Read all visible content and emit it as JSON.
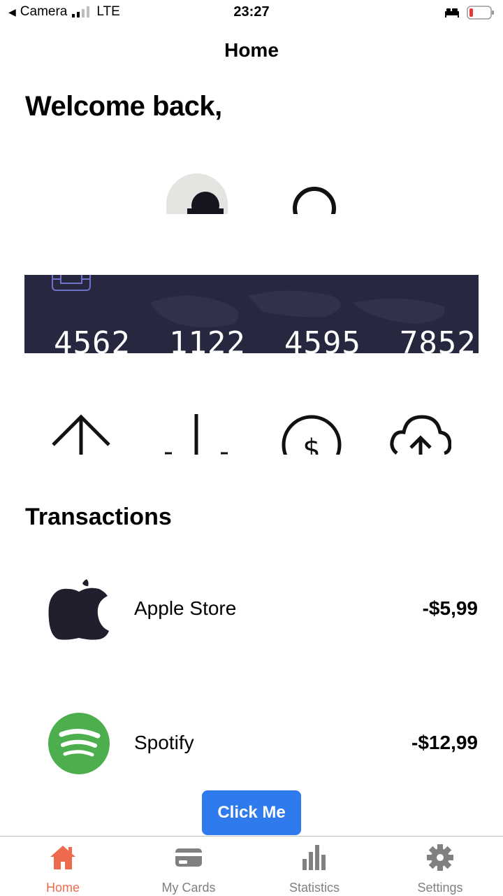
{
  "status_bar": {
    "back_app": "Camera",
    "network": "LTE",
    "time": "23:27"
  },
  "header": {
    "title": "Home"
  },
  "welcome_text": "Welcome back,",
  "card": {
    "number": "4562  1122  4595  7852",
    "color": "#27273f"
  },
  "actions": [
    {
      "icon": "arrow-up-icon"
    },
    {
      "icon": "arrow-down-icon"
    },
    {
      "icon": "dollar-circle-icon"
    },
    {
      "icon": "cloud-upload-icon"
    }
  ],
  "transactions": {
    "title": "Transactions",
    "items": [
      {
        "name": "Apple Store",
        "amount": "-$5,99",
        "icon": "apple-icon"
      },
      {
        "name": "Spotify",
        "amount": "-$12,99",
        "icon": "spotify-icon"
      }
    ]
  },
  "click_button": {
    "label": "Click Me",
    "color": "#2f7bee"
  },
  "tabbar": {
    "active_color": "#ee6a4d",
    "inactive_color": "#808080",
    "tabs": [
      {
        "label": "Home",
        "icon": "home-icon",
        "active": true
      },
      {
        "label": "My Cards",
        "icon": "card-icon",
        "active": false
      },
      {
        "label": "Statistics",
        "icon": "bar-chart-icon",
        "active": false
      },
      {
        "label": "Settings",
        "icon": "gear-icon",
        "active": false
      }
    ]
  }
}
